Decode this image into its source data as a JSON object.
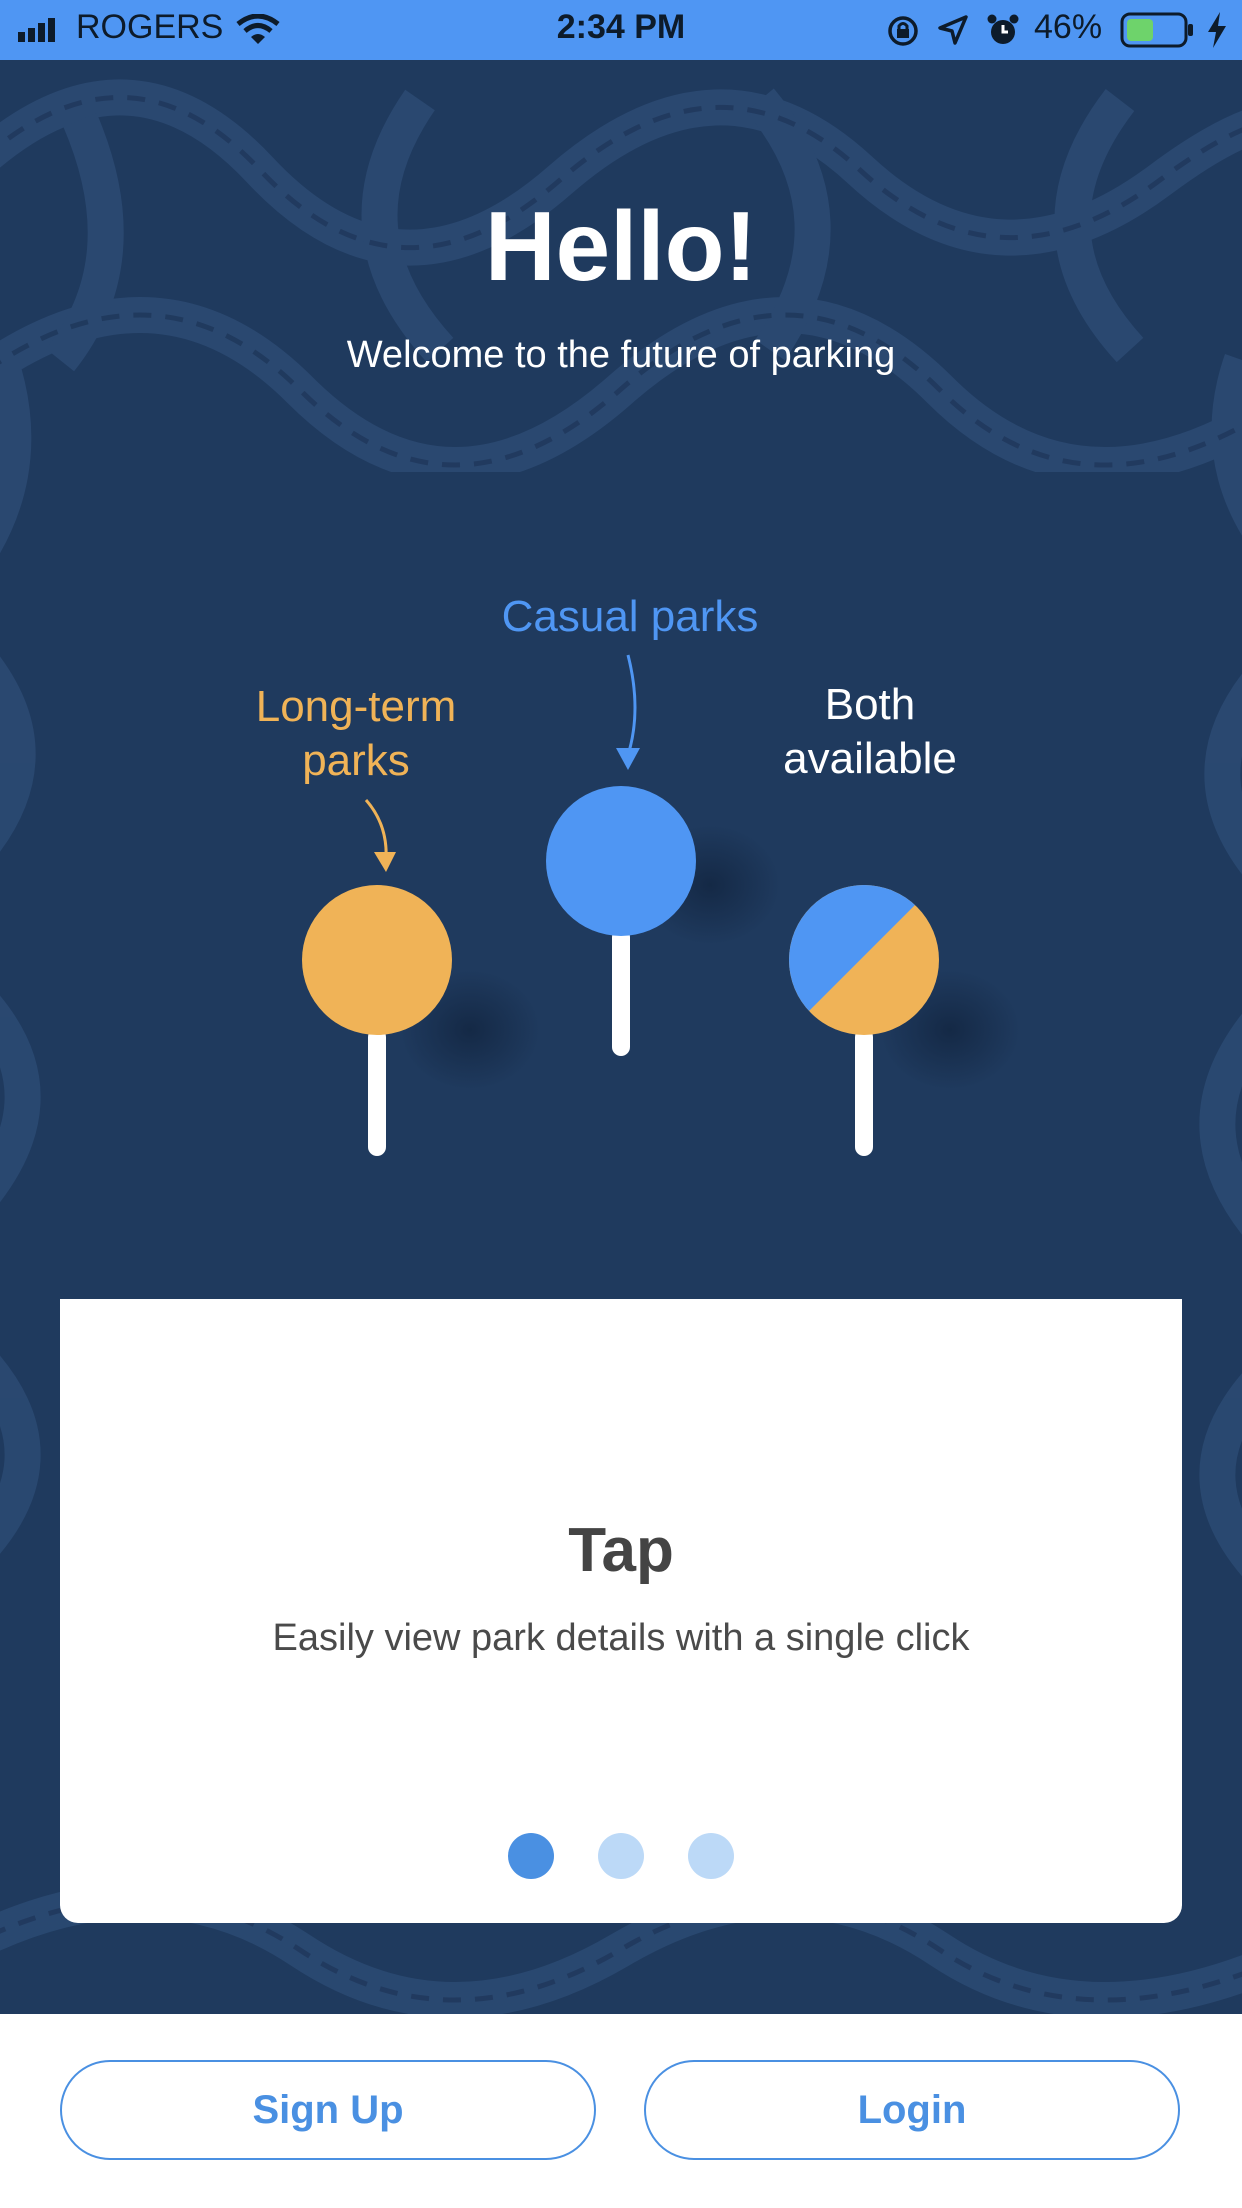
{
  "status_bar": {
    "carrier": "ROGERS",
    "time": "2:34 PM",
    "battery_percent": "46%",
    "icons": [
      "signal-icon",
      "wifi-icon",
      "orientation-lock-icon",
      "location-icon",
      "alarm-icon",
      "battery-icon",
      "charging-icon"
    ]
  },
  "hero": {
    "title": "Hello!",
    "subtitle": "Welcome to the future of parking"
  },
  "illustration": {
    "label_long_term": [
      "Long-term",
      "parks"
    ],
    "label_casual": "Casual parks",
    "label_both": [
      "Both",
      "available"
    ],
    "colors": {
      "long_term": "#f0b357",
      "casual": "#4f96f3",
      "background": "#1f3a5e"
    }
  },
  "card": {
    "title": "Tap",
    "description": "Easily view park details with a single click",
    "pagination": {
      "total": 3,
      "active": 1
    }
  },
  "actions": {
    "sign_up": "Sign Up",
    "login": "Login"
  },
  "colors": {
    "accent": "#4a90e2",
    "status_bar": "#4f96f3"
  }
}
